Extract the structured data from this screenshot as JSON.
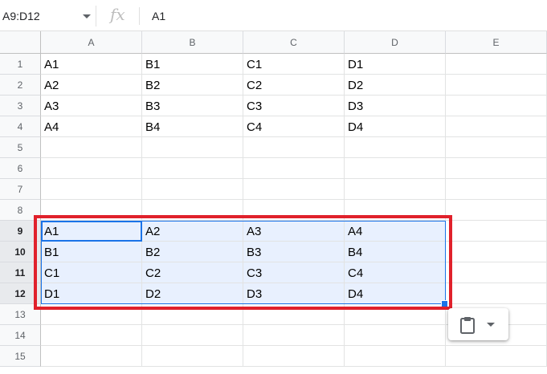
{
  "formula_bar": {
    "name_box": "A9:D12",
    "fx_label": "fx",
    "formula": "A1"
  },
  "columns": [
    "A",
    "B",
    "C",
    "D",
    "E"
  ],
  "rows": [
    "1",
    "2",
    "3",
    "4",
    "5",
    "6",
    "7",
    "8",
    "9",
    "10",
    "11",
    "12",
    "13",
    "14",
    "15"
  ],
  "cells": [
    [
      "A1",
      "B1",
      "C1",
      "D1",
      ""
    ],
    [
      "A2",
      "B2",
      "C2",
      "D2",
      ""
    ],
    [
      "A3",
      "B3",
      "C3",
      "D3",
      ""
    ],
    [
      "A4",
      "B4",
      "C4",
      "D4",
      ""
    ],
    [
      "",
      "",
      "",
      "",
      ""
    ],
    [
      "",
      "",
      "",
      "",
      ""
    ],
    [
      "",
      "",
      "",
      "",
      ""
    ],
    [
      "",
      "",
      "",
      "",
      ""
    ],
    [
      "A1",
      "A2",
      "A3",
      "A4",
      ""
    ],
    [
      "B1",
      "B2",
      "B3",
      "B4",
      ""
    ],
    [
      "C1",
      "C2",
      "C3",
      "C4",
      ""
    ],
    [
      "D1",
      "D2",
      "D3",
      "D4",
      ""
    ],
    [
      "",
      "",
      "",
      "",
      ""
    ],
    [
      "",
      "",
      "",
      "",
      ""
    ],
    [
      "",
      "",
      "",
      "",
      ""
    ]
  ],
  "selection": {
    "rows": [
      "9",
      "10",
      "11",
      "12"
    ],
    "columns": [
      "A",
      "B",
      "C",
      "D"
    ],
    "active": "A9"
  },
  "paste_icon": "clipboard-icon",
  "colors": {
    "selection": "#1a73e8",
    "selection_fill": "#e8f0fe",
    "highlight": "#e0212b"
  }
}
